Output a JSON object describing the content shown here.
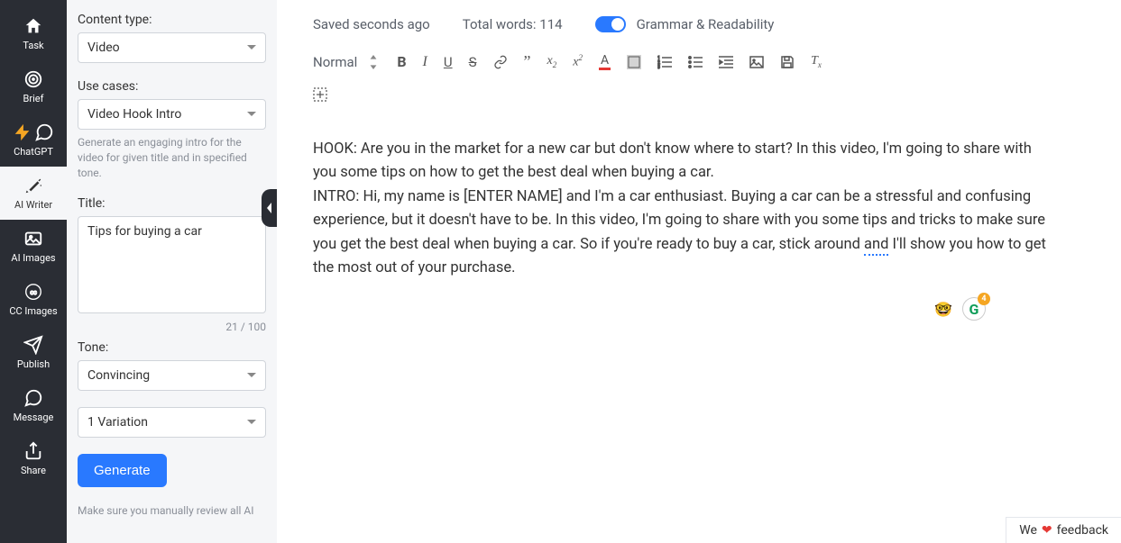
{
  "nav": {
    "task": "Task",
    "brief": "Brief",
    "chatgpt": "ChatGPT",
    "aiwriter": "AI Writer",
    "aiimages": "AI Images",
    "ccimages": "CC Images",
    "publish": "Publish",
    "message": "Message",
    "share": "Share"
  },
  "sidebar": {
    "content_type_label": "Content type:",
    "content_type_value": "Video",
    "use_cases_label": "Use cases:",
    "use_cases_value": "Video Hook Intro",
    "use_cases_hint": "Generate an engaging intro for the video for given title and in specified tone.",
    "title_label": "Title:",
    "title_value": "Tips for buying a car",
    "title_counter": "21 / 100",
    "tone_label": "Tone:",
    "tone_value": "Convincing",
    "variation_value": "1 Variation",
    "generate_label": "Generate",
    "review_hint": "Make sure you manually review all AI"
  },
  "topbar": {
    "saved": "Saved seconds ago",
    "total_words": "Total words: 114",
    "grammar": "Grammar & Readability"
  },
  "toolbar": {
    "normal": "Normal"
  },
  "editor": {
    "hook": "HOOK: Are you in the market for a new car but don't know where to start? In this video, I'm going to share with you some tips on how to get the best deal when buying a car.",
    "intro_part1": "INTRO: Hi, my name is [ENTER NAME] and I'm a car enthusiast. Buying a car can be a stressful and confusing experience, but it doesn't have to be. In this video, I'm going to share with you some tips and tricks to make sure you get the best deal when buying a car. So if you're ready to buy a car, stick around ",
    "intro_underline": "and",
    "intro_part2": " I'll show you how to get the most out of your purchase."
  },
  "widgets": {
    "emoji": "🤓",
    "g": "G",
    "badge": "4"
  },
  "feedback": {
    "we": "We",
    "text": "feedback"
  }
}
